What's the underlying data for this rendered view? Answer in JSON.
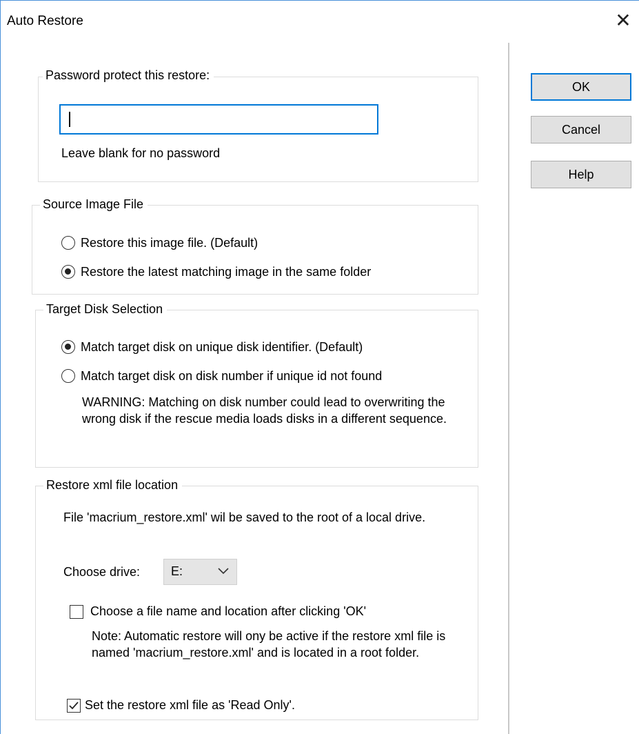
{
  "window": {
    "title": "Auto Restore",
    "close_glyph": "✕"
  },
  "buttons": {
    "ok": "OK",
    "cancel": "Cancel",
    "help": "Help"
  },
  "password": {
    "legend": "Password protect this restore:",
    "value": "",
    "hint": "Leave blank for no password"
  },
  "source": {
    "legend": "Source Image File",
    "options": [
      {
        "label": "Restore this image file. (Default)",
        "selected": false
      },
      {
        "label": "Restore the latest matching image in the same folder",
        "selected": true
      }
    ]
  },
  "target": {
    "legend": "Target Disk Selection",
    "options": [
      {
        "label": "Match target disk on unique disk identifier. (Default)",
        "selected": true
      },
      {
        "label": "Match target disk on disk number if unique id not found",
        "selected": false
      }
    ],
    "warning": "WARNING: Matching on disk number could lead to overwriting the wrong disk if the rescue media loads disks in a different sequence."
  },
  "xml": {
    "legend": "Restore xml file location",
    "info": "File 'macrium_restore.xml' wil be saved to the root of a local drive.",
    "drive_label": "Choose drive:",
    "drive_value": "E:",
    "choose_file": {
      "label": "Choose a file name and location after clicking 'OK'",
      "checked": false
    },
    "note": "Note:  Automatic restore will ony be active if the restore xml file is named 'macrium_restore.xml' and is located in a root folder.",
    "read_only": {
      "label": "Set the restore xml file as 'Read Only'.",
      "checked": true
    }
  },
  "colors": {
    "accent": "#0078d7",
    "button_bg": "#e1e1e1",
    "group_border": "#dcdcdc"
  }
}
